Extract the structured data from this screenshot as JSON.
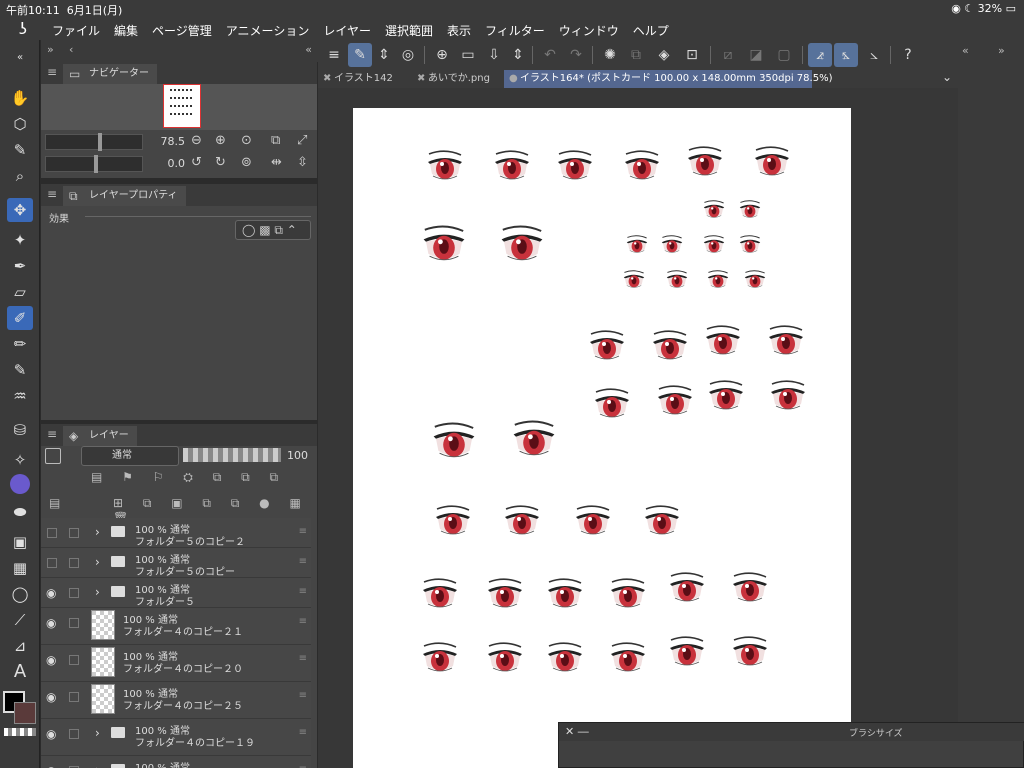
{
  "status": {
    "time": "午前10:11",
    "date": "6月1日(月)",
    "battery": "32%"
  },
  "menu": [
    "ファイル",
    "編集",
    "ページ管理",
    "アニメーション",
    "レイヤー",
    "選択範囲",
    "表示",
    "フィルター",
    "ウィンドウ",
    "ヘルプ"
  ],
  "navigator": {
    "title": "ナビゲーター",
    "zoom": "78.5",
    "rotation": "0.0"
  },
  "layer_property": {
    "title": "レイヤープロパティ",
    "effect_label": "効果"
  },
  "layers": {
    "title": "レイヤー",
    "blend_mode": "通常",
    "opacity": "100",
    "rows": [
      {
        "mode": "100 % 通常",
        "name": "フォルダー５のコピー２",
        "type": "folder",
        "visible": false
      },
      {
        "mode": "100 % 通常",
        "name": "フォルダー５のコピー",
        "type": "folder",
        "visible": false
      },
      {
        "mode": "100 % 通常",
        "name": "フォルダー５",
        "type": "folder",
        "visible": true
      },
      {
        "mode": "100 % 通常",
        "name": "フォルダー４のコピー２１",
        "type": "layer",
        "visible": true
      },
      {
        "mode": "100 % 通常",
        "name": "フォルダー４のコピー２０",
        "type": "layer",
        "visible": true
      },
      {
        "mode": "100 % 通常",
        "name": "フォルダー４のコピー２５",
        "type": "layer",
        "visible": true
      },
      {
        "mode": "100 % 通常",
        "name": "フォルダー４のコピー１９",
        "type": "folder",
        "visible": true
      },
      {
        "mode": "100 % 通常",
        "name": "",
        "type": "folder",
        "visible": true
      }
    ]
  },
  "tabs": [
    {
      "label": "イラスト142",
      "active": false
    },
    {
      "label": "あいでか.png",
      "active": false
    },
    {
      "label": "イラスト164* (ポストカード 100.00 x 148.00mm 350dpi 78.5%)",
      "active": true
    }
  ],
  "brush_panel": {
    "title": "ブラシサイズ"
  },
  "colors": {
    "eye_iris": "#c8323c",
    "accent_active": "#3a69b8",
    "tab_active": "#546790"
  }
}
